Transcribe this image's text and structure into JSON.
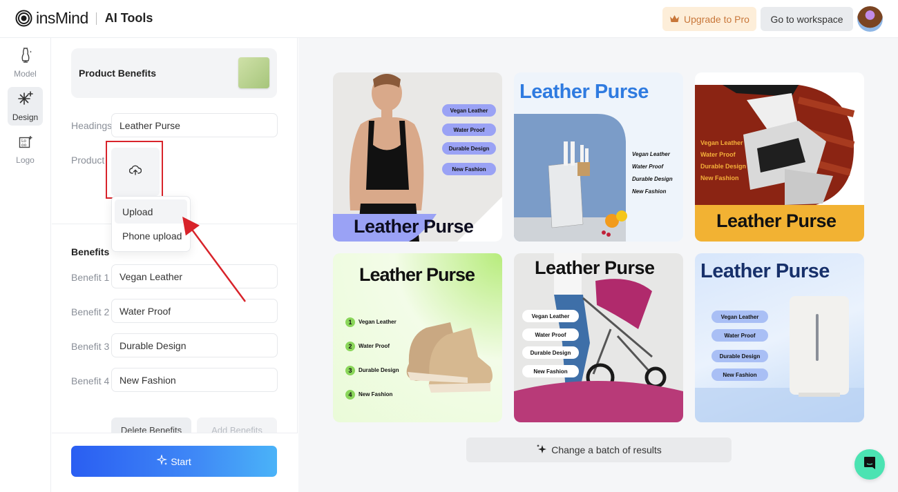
{
  "header": {
    "brand_name": "insMind",
    "section_title": "AI Tools",
    "upgrade_label": "Upgrade to Pro",
    "workspace_label": "Go to workspace",
    "upgrade_color": "#c8773a"
  },
  "rail": {
    "items": [
      {
        "label": "Model",
        "icon": "dress-form-icon",
        "active": false
      },
      {
        "label": "Design",
        "icon": "magic-sparkle-icon",
        "active": true
      },
      {
        "label": "Logo",
        "icon": "logo-grid-icon",
        "active": false
      }
    ]
  },
  "panel": {
    "template_title": "Product Benefits",
    "headings_label": "Headings",
    "headings_value": "Leather Purse",
    "product_label": "Product",
    "upload_menu": [
      "Upload",
      "Phone upload"
    ],
    "benefits_title": "Benefits",
    "benefits": [
      {
        "label": "Benefit 1",
        "value": "Vegan Leather"
      },
      {
        "label": "Benefit 2",
        "value": "Water Proof"
      },
      {
        "label": "Benefit 3",
        "value": "Durable Design"
      },
      {
        "label": "Benefit 4",
        "value": "New Fashion"
      }
    ],
    "delete_label": "Delete Benefits",
    "add_label": "Add Benefits",
    "start_label": "Start"
  },
  "results": {
    "headline": "Leather Purse",
    "benefits": [
      "Vegan Leather",
      "Water Proof",
      "Durable Design",
      "New Fashion"
    ],
    "numbers": [
      "1",
      "2",
      "3",
      "4"
    ],
    "cards": [
      {
        "theme": "sports-bra-model",
        "accent": "#9aa2f5"
      },
      {
        "theme": "knife-block",
        "accent": "#2f7be0"
      },
      {
        "theme": "sneakers",
        "accent": "#f2b233"
      },
      {
        "theme": "kids-boots",
        "accent": "#b7ec7c"
      },
      {
        "theme": "baby-stroller",
        "accent": "#b83a78"
      },
      {
        "theme": "humidifier",
        "accent": "#17306a"
      }
    ],
    "batch_label": "Change a batch of results"
  }
}
